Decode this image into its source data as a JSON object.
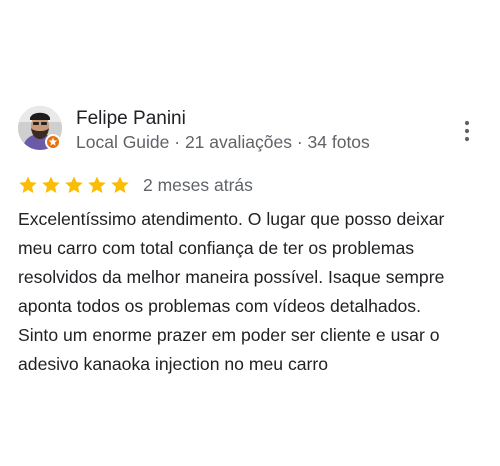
{
  "reviewer": {
    "name": "Felipe Panini",
    "meta": "Local Guide · 21 avaliações · 34 fotos"
  },
  "review": {
    "rating": 5,
    "max_rating": 5,
    "date": "2 meses atrás",
    "lines": [
      "Excelentíssimo atendimento. O lugar que posso deixar",
      "meu carro com total confiança de ter os problemas",
      "resolvidos da melhor maneira possível. Isaque sempre",
      "aponta todos os problemas com vídeos detalhados.",
      "Sinto um enorme prazer em poder ser cliente e usar o",
      "adesivo kanaoka injection no meu carro"
    ]
  },
  "icons": {
    "star": "star-icon",
    "more": "more-vert-icon",
    "badge": "local-guide-badge-icon"
  },
  "colors": {
    "star": "#fbbc04",
    "badge": "#e8710a",
    "text": "#202124",
    "secondary": "#5f6368"
  }
}
